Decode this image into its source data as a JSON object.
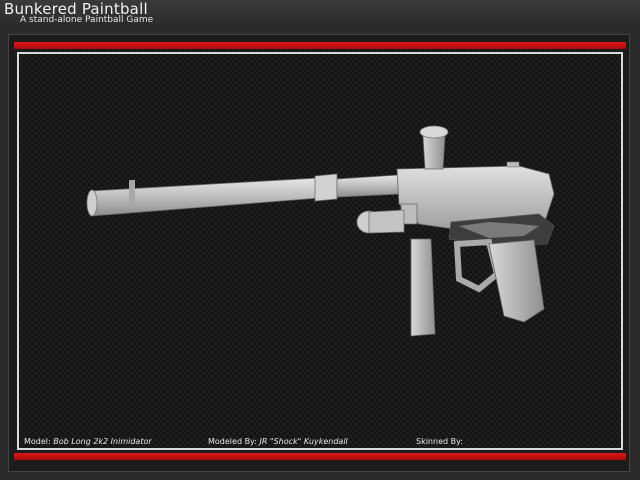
{
  "header": {
    "title": "Bunkered Paintball",
    "subtitle": "A stand-alone Paintball Game"
  },
  "viewer": {
    "model_label": "Model:",
    "model_value": "Bob Long 2k2 Inimidator",
    "modeled_label": "Modeled By:",
    "modeled_value": "JR \"Shock\" Kuykendall",
    "skinned_label": "Skinned By:",
    "skinned_value": ""
  },
  "colors": {
    "accent_red": "#d01010",
    "frame_border": "#d9d9d9",
    "model_gray": "#c8c8c8"
  },
  "icons": {
    "model": "paintball-marker-render"
  }
}
